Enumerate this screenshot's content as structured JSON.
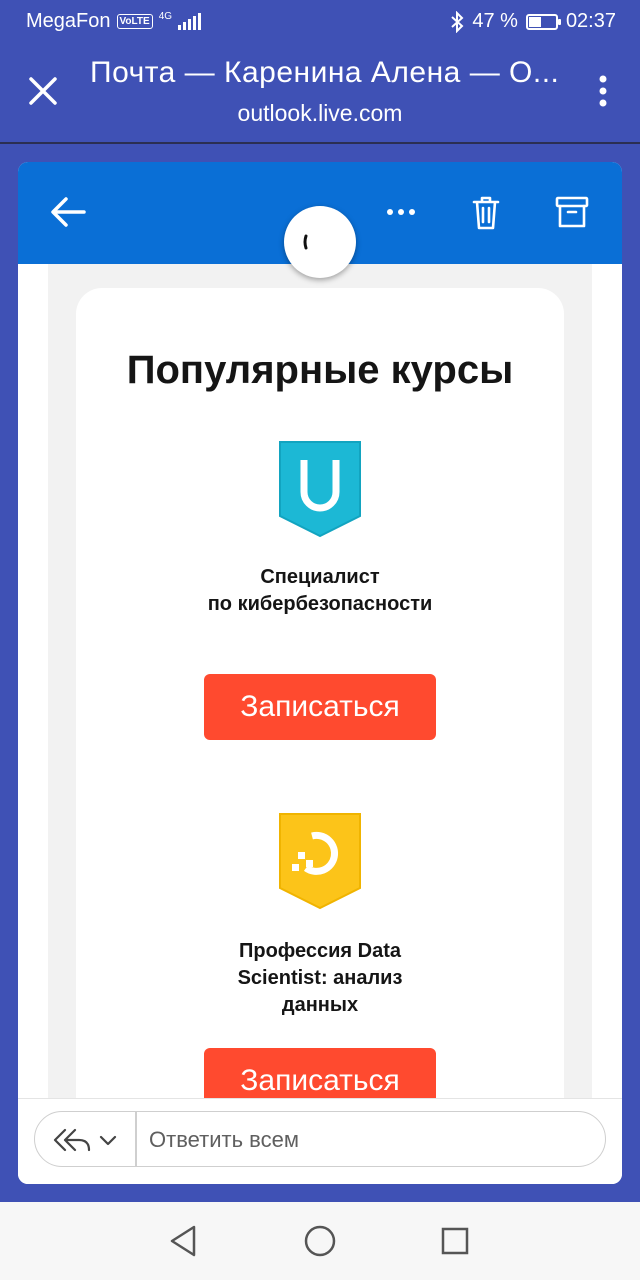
{
  "status_bar": {
    "carrier": "MegaFon",
    "volte": "VoLTE",
    "network": "4G",
    "battery": "47 %",
    "battery_level_percent": 47,
    "time": "02:37"
  },
  "browser": {
    "title": "Почта — Каренина Алена — О...",
    "url": "outlook.live.com"
  },
  "mail_toolbar": {
    "icons": [
      "back-arrow-icon",
      "more-dots-icon",
      "trash-icon",
      "archive-icon"
    ]
  },
  "email": {
    "heading": "Популярные курсы",
    "courses": [
      {
        "name_line1": "Специалист",
        "name_line2": "по кибербезопасности",
        "button": "Записаться",
        "icon": "shield-cyber-icon",
        "color": "#1cb8d5"
      },
      {
        "name_line1": "Профессия Data",
        "name_line2": "Scientist: анализ",
        "name_line3": "данных",
        "button": "Записаться",
        "icon": "data-science-badge-icon",
        "color": "#fcc419"
      }
    ]
  },
  "reply": {
    "placeholder": "Ответить всем"
  },
  "colors": {
    "app_bar": "#3f51b5",
    "toolbar": "#0a6fd6",
    "button": "#ff4a2f"
  }
}
